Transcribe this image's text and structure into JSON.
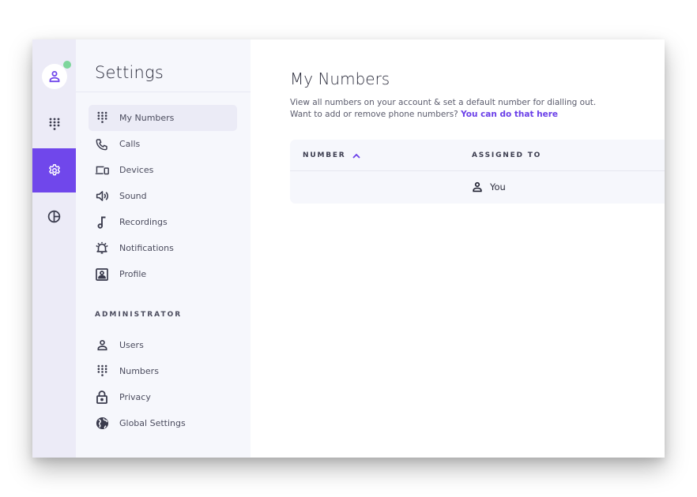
{
  "rail": {
    "items": [
      {
        "name": "profile",
        "icon": "user-icon",
        "presence": "online"
      },
      {
        "name": "dialpad",
        "icon": "dialpad-icon"
      },
      {
        "name": "settings",
        "icon": "gear-icon",
        "active": true
      },
      {
        "name": "statistics",
        "icon": "pie-chart-icon"
      }
    ],
    "accent": "#7047eb",
    "presence_color": "#7ed69c"
  },
  "settings": {
    "title": "Settings",
    "items": [
      {
        "label": "My Numbers",
        "icon": "dialpad-icon",
        "active": true
      },
      {
        "label": "Calls",
        "icon": "phone-icon"
      },
      {
        "label": "Devices",
        "icon": "devices-icon"
      },
      {
        "label": "Sound",
        "icon": "speaker-icon"
      },
      {
        "label": "Recordings",
        "icon": "music-note-icon"
      },
      {
        "label": "Notifications",
        "icon": "bell-ringing-icon"
      },
      {
        "label": "Profile",
        "icon": "profile-card-icon"
      }
    ],
    "admin_heading": "ADMINISTRATOR",
    "admin_items": [
      {
        "label": "Users",
        "icon": "user-icon"
      },
      {
        "label": "Numbers",
        "icon": "dialpad-icon"
      },
      {
        "label": "Privacy",
        "icon": "lock-icon"
      },
      {
        "label": "Global Settings",
        "icon": "globe-icon"
      }
    ]
  },
  "main": {
    "title": "My Numbers",
    "description_line1": "View all numbers on your account & set a default number for dialling out.",
    "description_line2": "Want to add or remove phone numbers?",
    "link_text": "You can do that here",
    "link_color": "#6a3fe8",
    "table": {
      "columns": [
        {
          "label": "NUMBER",
          "sort": "ascending"
        },
        {
          "label": "ASSIGNED TO"
        }
      ],
      "rows": [
        {
          "number": "",
          "assigned_to": "You",
          "assigned_icon": "user-icon"
        }
      ]
    }
  }
}
